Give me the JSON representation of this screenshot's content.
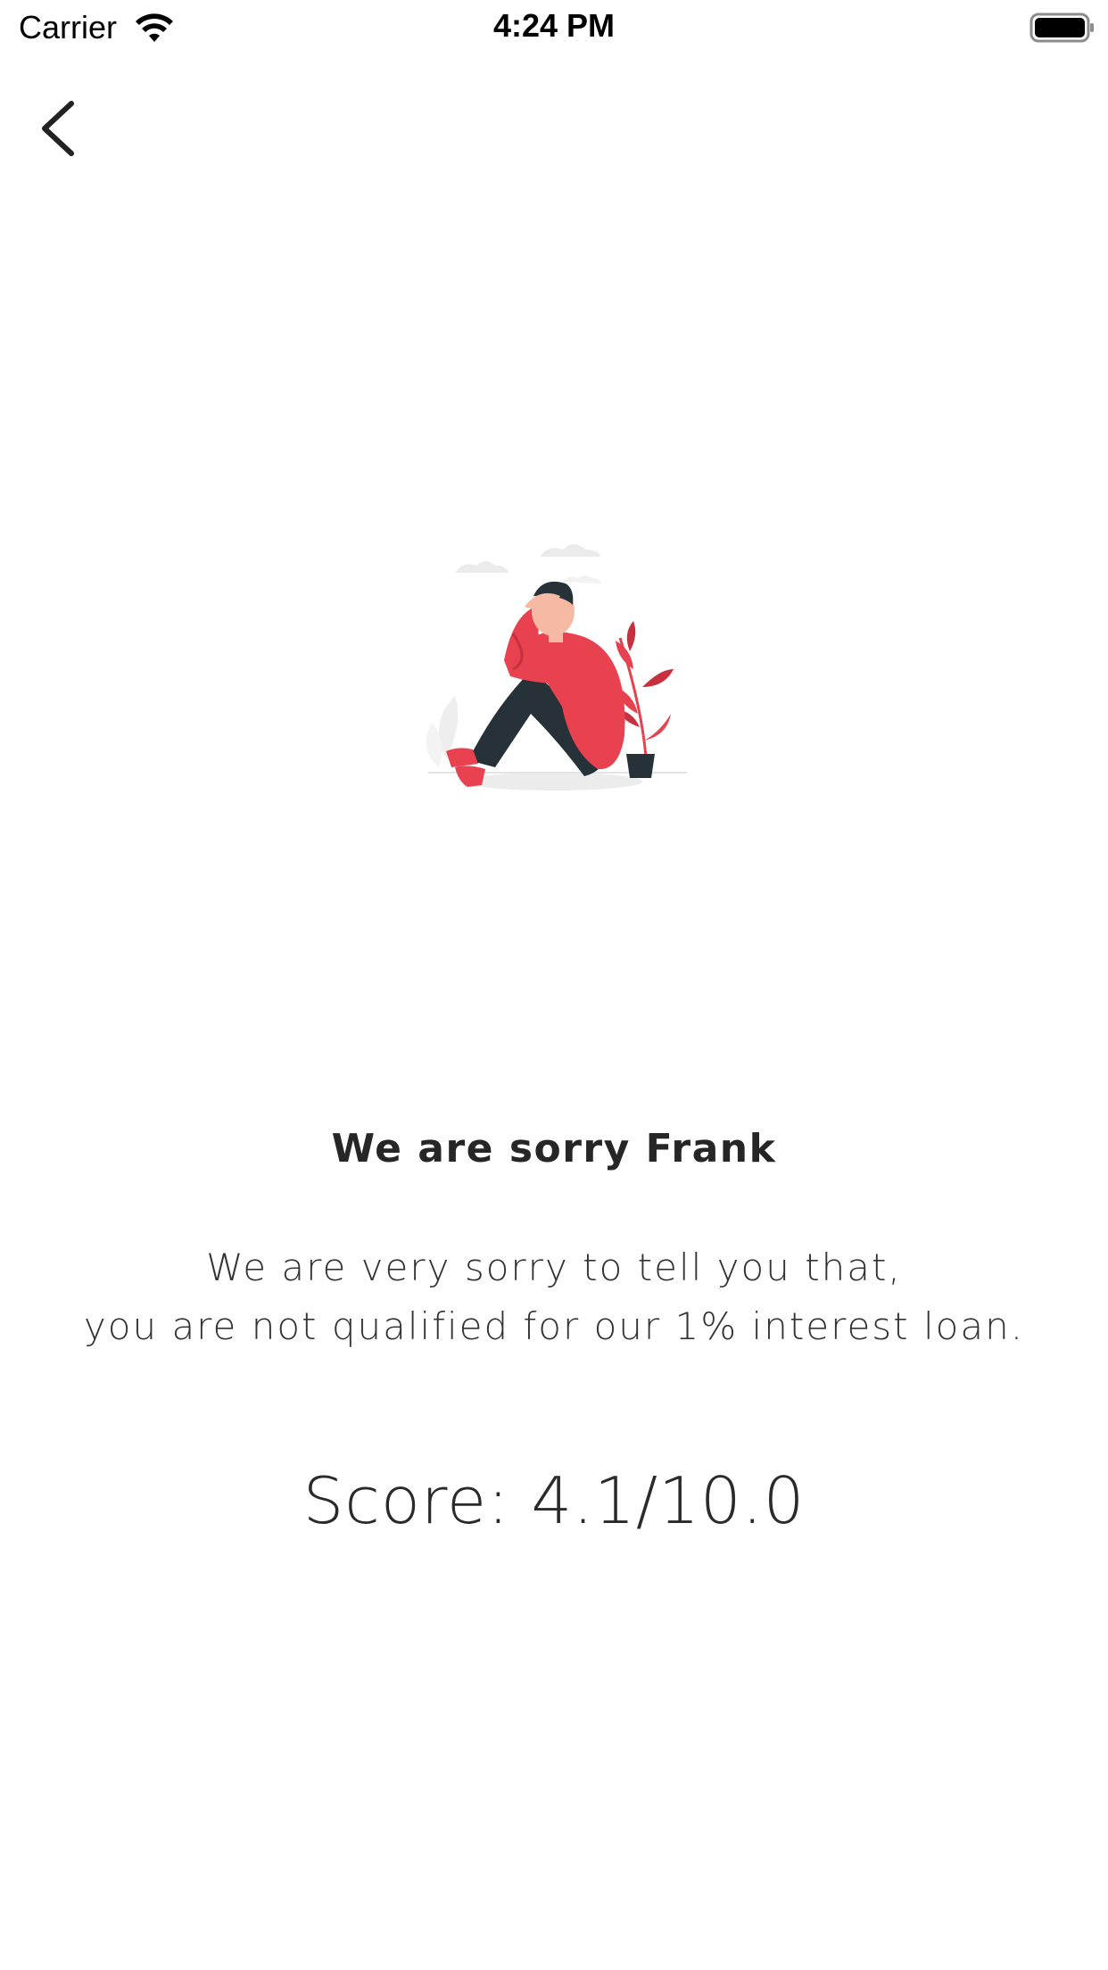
{
  "status_bar": {
    "carrier": "Carrier",
    "time": "4:24 PM",
    "wifi_icon": "wifi-icon",
    "battery_icon": "battery-icon"
  },
  "nav": {
    "back_icon": "chevron-left-icon"
  },
  "illustration": {
    "name": "sad-person-illustration",
    "accent_color": "#e8414f",
    "dark_color": "#263238"
  },
  "content": {
    "title": "We are sorry Frank",
    "message_line1": "We are very sorry to tell you that,",
    "message_line2": "you are not qualified for our 1% interest loan.",
    "score": "Score: 4.1/10.0"
  }
}
